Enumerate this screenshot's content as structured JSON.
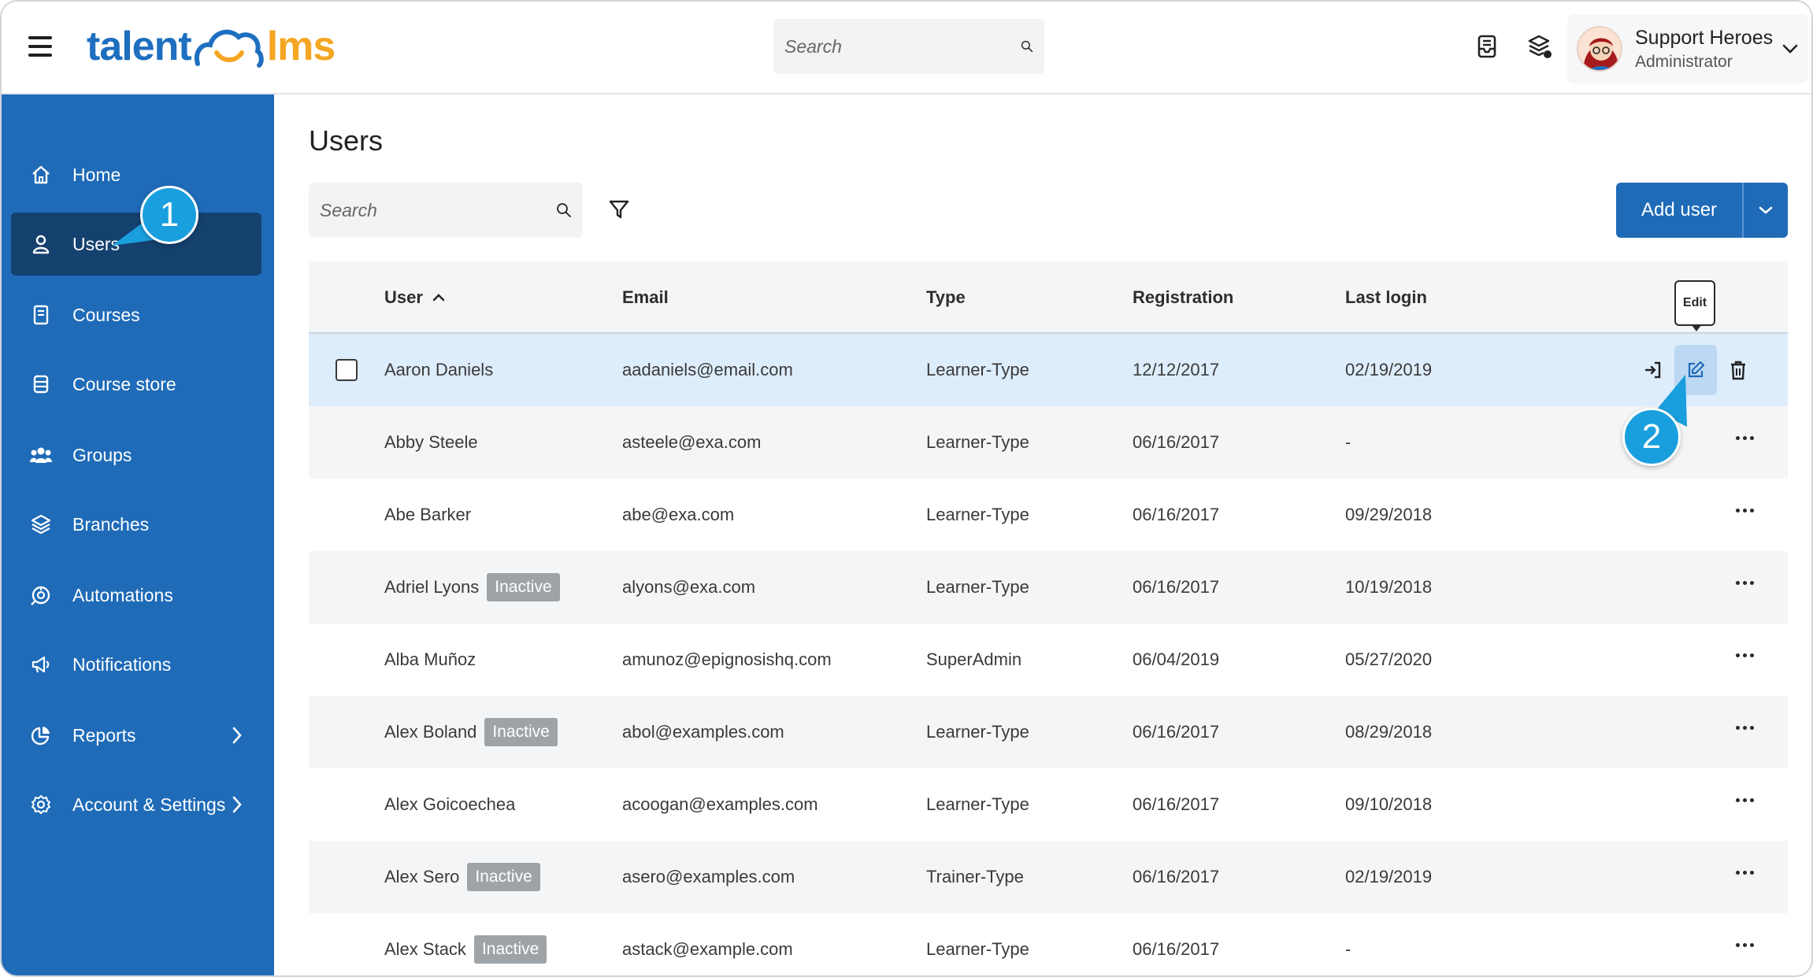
{
  "app": {
    "logo_left": "talent",
    "logo_right": "lms"
  },
  "header": {
    "search_placeholder": "Search",
    "user_name": "Support Heroes",
    "user_role": "Administrator"
  },
  "sidebar": {
    "items": [
      {
        "label": "Home"
      },
      {
        "label": "Users"
      },
      {
        "label": "Courses"
      },
      {
        "label": "Course store"
      },
      {
        "label": "Groups"
      },
      {
        "label": "Branches"
      },
      {
        "label": "Automations"
      },
      {
        "label": "Notifications"
      },
      {
        "label": "Reports"
      },
      {
        "label": "Account & Settings"
      }
    ]
  },
  "callouts": {
    "one": "1",
    "two": "2"
  },
  "main": {
    "title": "Users",
    "search_placeholder": "Search",
    "add_user_label": "Add user",
    "tooltip": "Edit",
    "columns": {
      "user": "User",
      "email": "Email",
      "type": "Type",
      "registration": "Registration",
      "last_login": "Last login"
    },
    "rows": [
      {
        "name": "Aaron Daniels",
        "status": "",
        "email": "aadaniels@email.com",
        "type": "Learner-Type",
        "registration": "12/12/2017",
        "last_login": "02/19/2019"
      },
      {
        "name": "Abby Steele",
        "status": "",
        "email": "asteele@exa.com",
        "type": "Learner-Type",
        "registration": "06/16/2017",
        "last_login": "-"
      },
      {
        "name": "Abe Barker",
        "status": "",
        "email": "abe@exa.com",
        "type": "Learner-Type",
        "registration": "06/16/2017",
        "last_login": "09/29/2018"
      },
      {
        "name": "Adriel Lyons",
        "status": "Inactive",
        "email": "alyons@exa.com",
        "type": "Learner-Type",
        "registration": "06/16/2017",
        "last_login": "10/19/2018"
      },
      {
        "name": "Alba Muñoz",
        "status": "",
        "email": "amunoz@epignosishq.com",
        "type": "SuperAdmin",
        "registration": "06/04/2019",
        "last_login": "05/27/2020"
      },
      {
        "name": "Alex Boland",
        "status": "Inactive",
        "email": "abol@examples.com",
        "type": "Learner-Type",
        "registration": "06/16/2017",
        "last_login": "08/29/2018"
      },
      {
        "name": "Alex Goicoechea",
        "status": "",
        "email": "acoogan@examples.com",
        "type": "Learner-Type",
        "registration": "06/16/2017",
        "last_login": "09/10/2018"
      },
      {
        "name": "Alex Sero",
        "status": "Inactive",
        "email": "asero@examples.com",
        "type": "Trainer-Type",
        "registration": "06/16/2017",
        "last_login": "02/19/2019"
      },
      {
        "name": "Alex Stack",
        "status": "Inactive",
        "email": "astack@example.com",
        "type": "Learner-Type",
        "registration": "06/16/2017",
        "last_login": "-"
      }
    ]
  },
  "colors": {
    "brand_blue": "#1f6bb8",
    "active_nav": "#15416f",
    "logo_orange": "#f5a623",
    "callout": "#1a9fde",
    "row_highlight": "#deedfb"
  }
}
